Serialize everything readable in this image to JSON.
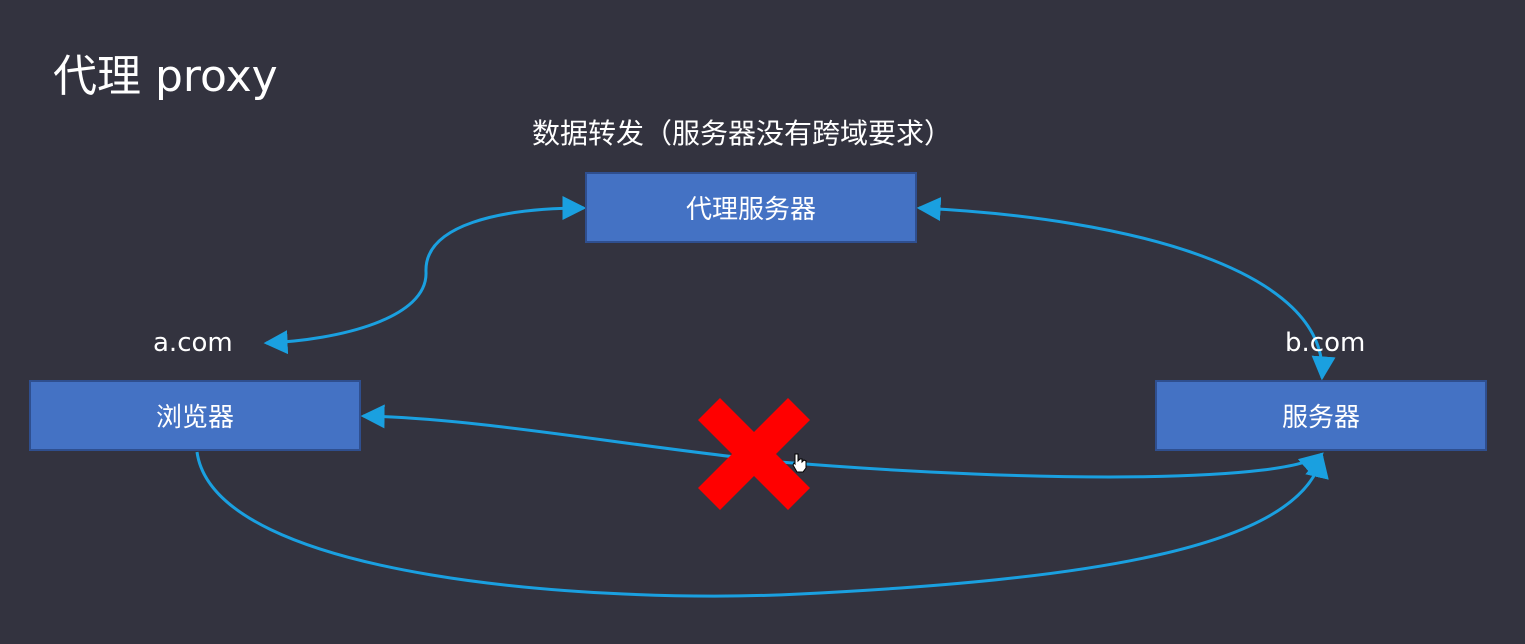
{
  "slide": {
    "title": "代理 proxy",
    "subtitle": "数据转发（服务器没有跨域要求）"
  },
  "nodes": {
    "proxy_server": "代理服务器",
    "browser": "浏览器",
    "server": "服务器"
  },
  "domains": {
    "a": "a.com",
    "b": "b.com"
  },
  "colors": {
    "background": "#33333f",
    "box_fill": "#4472c4",
    "arrow": "#1aa0e0",
    "blocked_cross": "#ff0000"
  },
  "icons": {
    "blocked": "red-x-cross-icon",
    "cursor": "hand-pointer-icon"
  }
}
